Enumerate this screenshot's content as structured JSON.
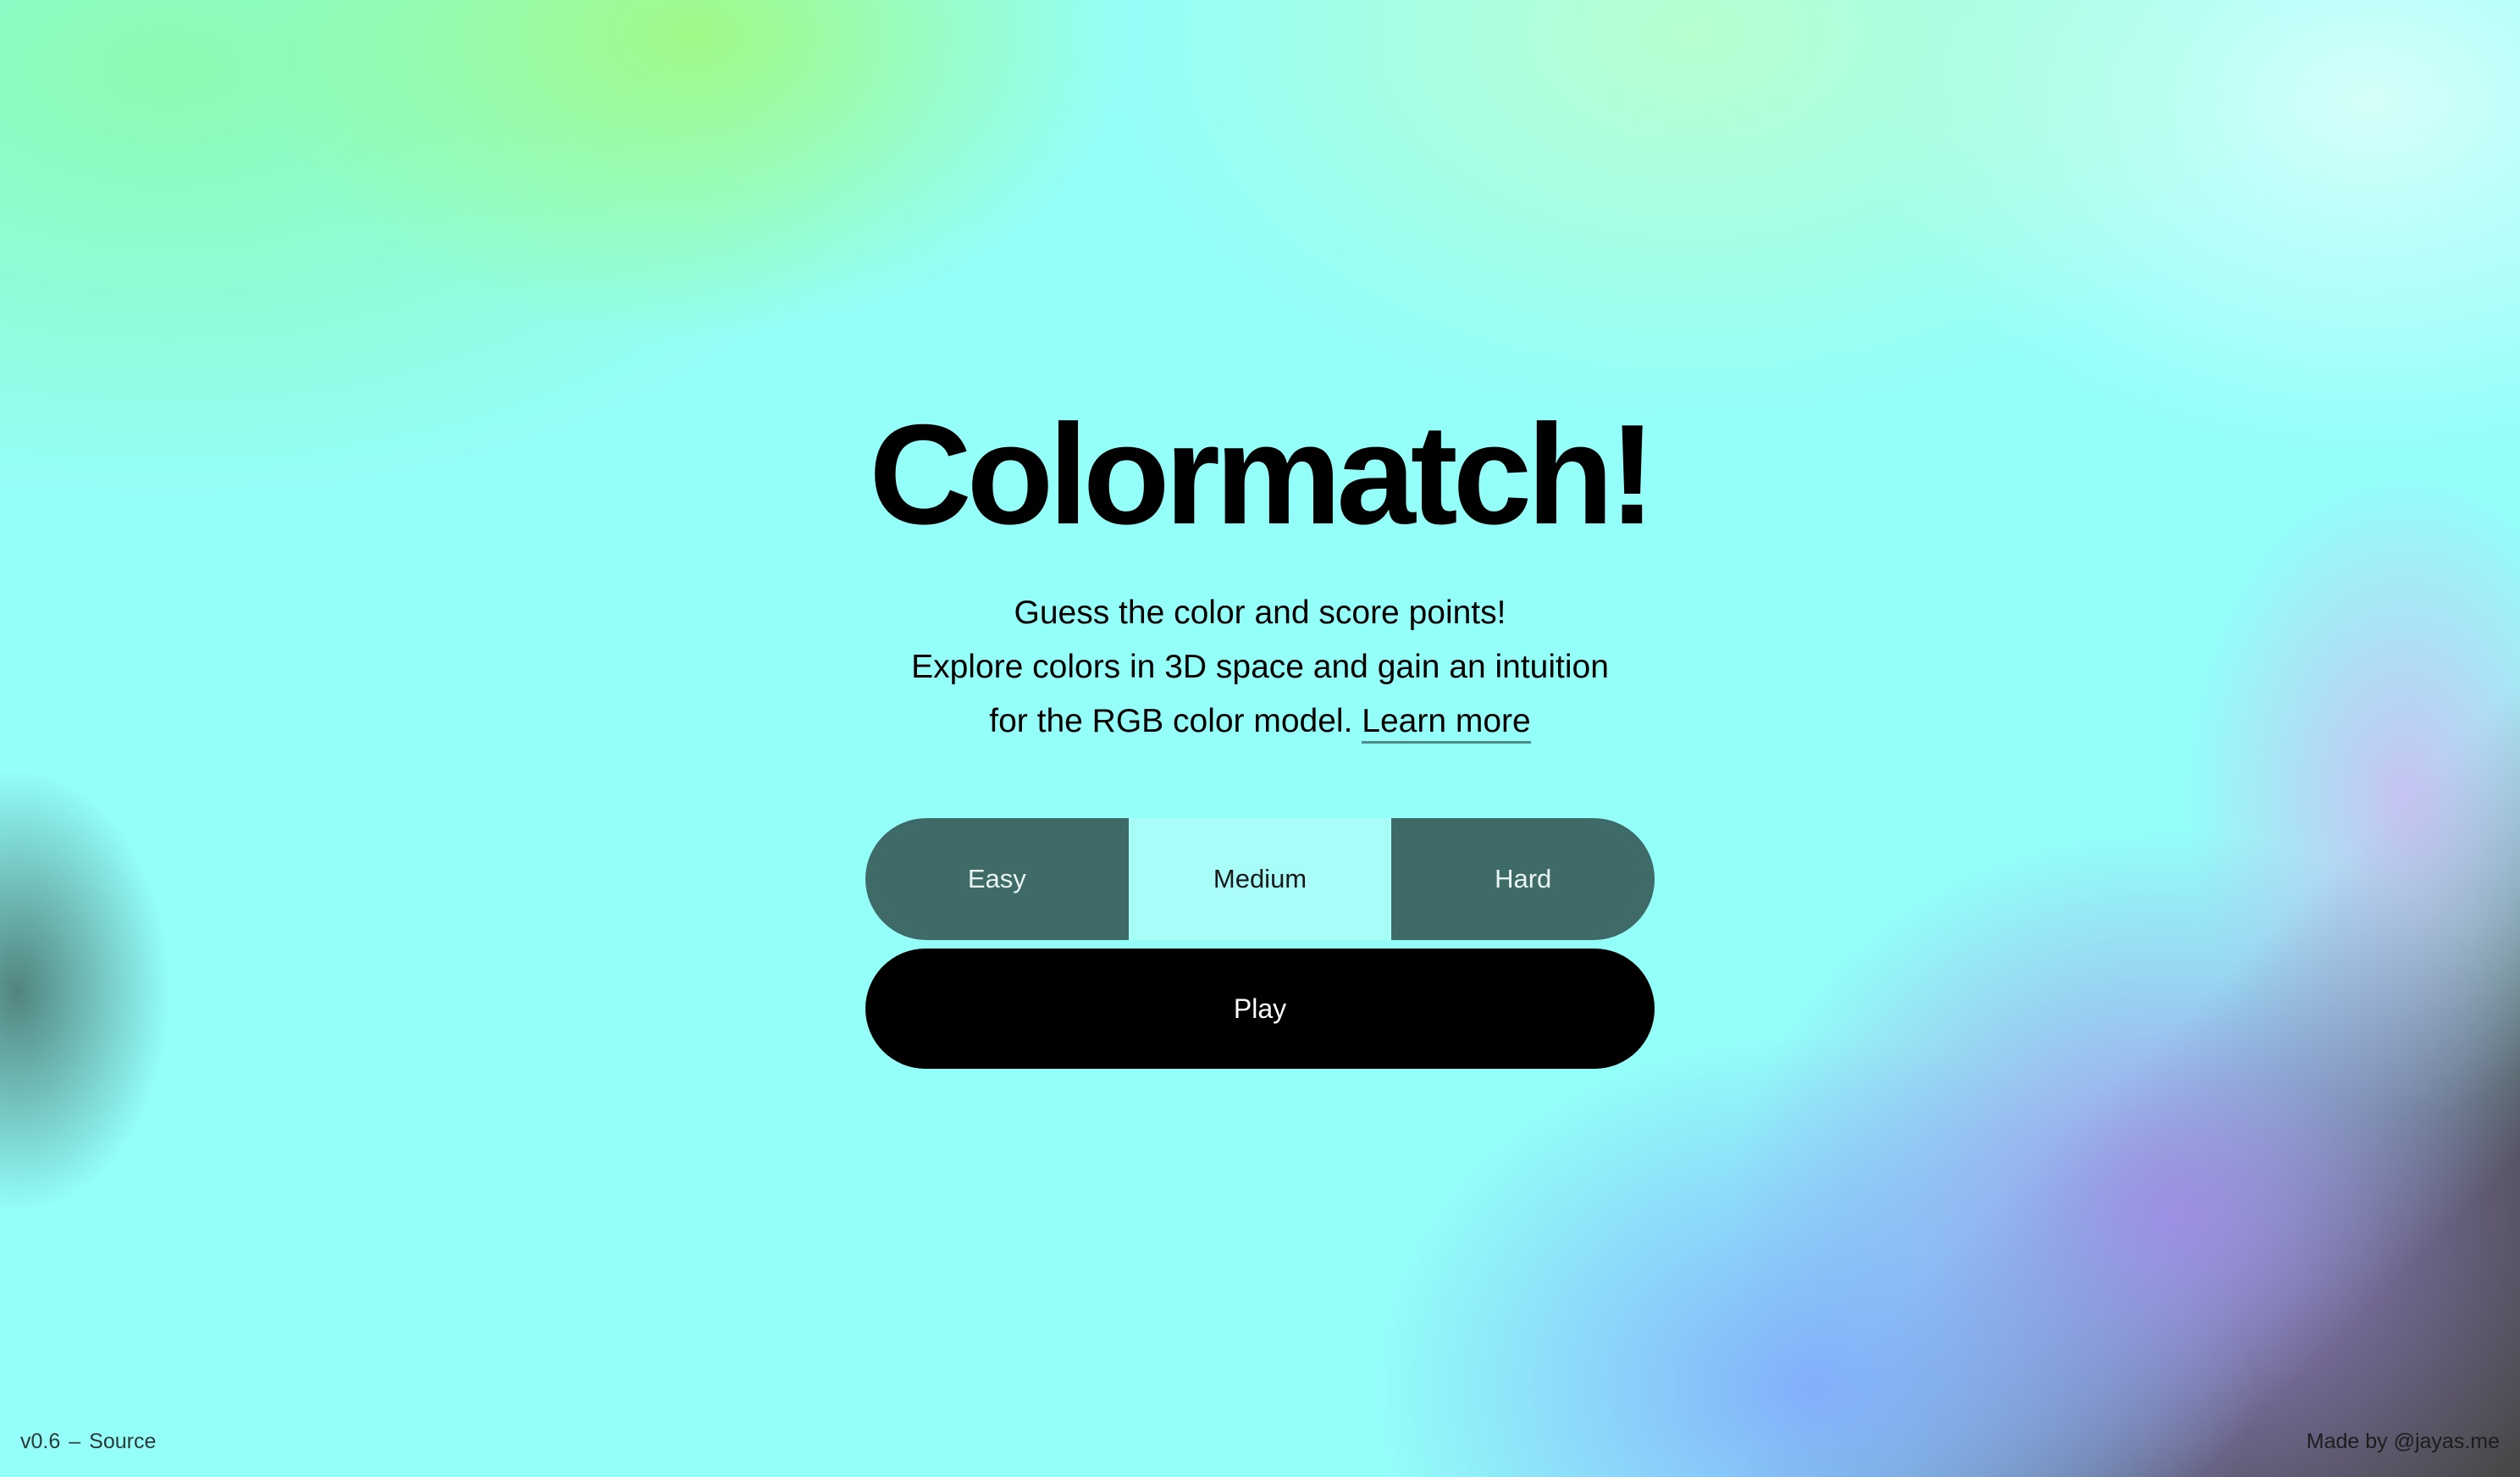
{
  "app": {
    "title": "Colormatch!",
    "subtitle": {
      "line1": "Guess the color and score points!",
      "line2": "Explore colors in 3D space and gain an intuition",
      "line3": "for the RGB color model.",
      "learn_more": "Learn more"
    }
  },
  "difficulty": {
    "options": [
      {
        "label": "Easy",
        "selected": false
      },
      {
        "label": "Medium",
        "selected": true
      },
      {
        "label": "Hard",
        "selected": false
      }
    ]
  },
  "play": {
    "label": "Play"
  },
  "footer": {
    "version": "v0.6",
    "separator": "–",
    "source_label": "Source",
    "credit": "Made by @jayas.me"
  },
  "colors": {
    "background_base": "#94fef9",
    "unselected_button": "#3e6a67",
    "selected_button": "#a8fdf8",
    "play_button": "#000000"
  }
}
